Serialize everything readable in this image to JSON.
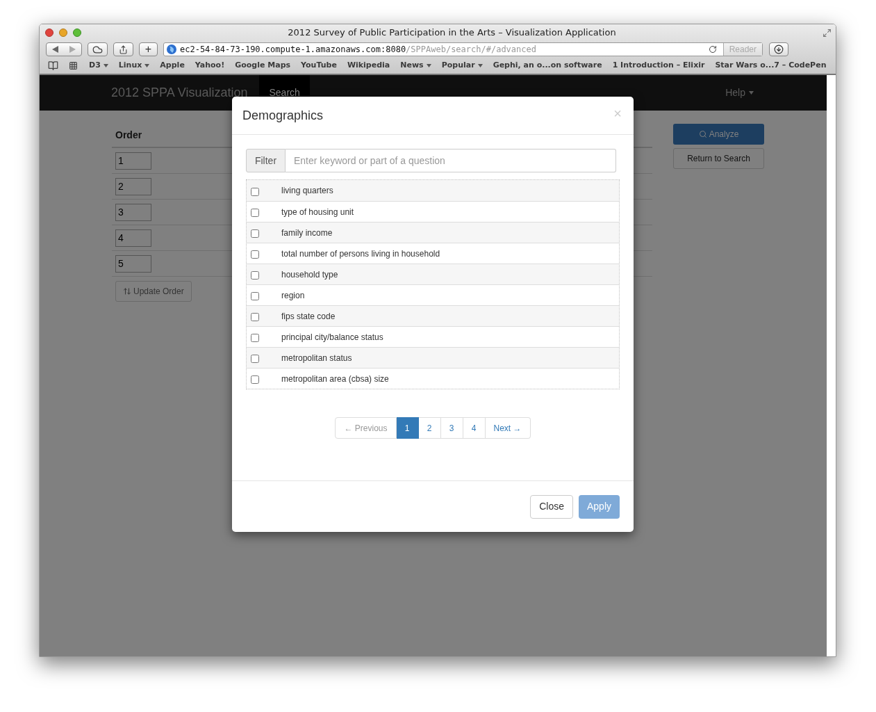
{
  "browser": {
    "title": "2012 Survey of Public Participation in the Arts – Visualization Application",
    "address": {
      "host": "ec2-54-84-73-190.compute-1.amazonaws.com:8080",
      "path": "/SPPAweb/search/#/advanced"
    },
    "reader": "Reader",
    "new_tab": "+",
    "bookmarks": [
      {
        "label": "D3",
        "menu": true
      },
      {
        "label": "Linux",
        "menu": true
      },
      {
        "label": "Apple",
        "menu": false
      },
      {
        "label": "Yahoo!",
        "menu": false
      },
      {
        "label": "Google Maps",
        "menu": false
      },
      {
        "label": "YouTube",
        "menu": false
      },
      {
        "label": "Wikipedia",
        "menu": false
      },
      {
        "label": "News",
        "menu": true
      },
      {
        "label": "Popular",
        "menu": true
      },
      {
        "label": "Gephi, an o...on software",
        "menu": false
      },
      {
        "label": "1 Introduction – Elixir",
        "menu": false
      },
      {
        "label": "Star Wars o...7 – CodePen",
        "menu": false
      }
    ]
  },
  "app": {
    "brand": "2012 SPPA Visualization",
    "nav": [
      {
        "label": "Search",
        "selected": true
      }
    ],
    "help": "Help"
  },
  "order": {
    "header": "Order",
    "inputs": [
      "1",
      "2",
      "3",
      "4",
      "5"
    ],
    "update_button": "Update Order"
  },
  "actions": {
    "analyze": "Analyze",
    "return": "Return to Search"
  },
  "modal": {
    "title": "Demographics",
    "close": "×",
    "filter_label": "Filter",
    "filter_placeholder": "Enter keyword or part of a question",
    "items": [
      {
        "label": "living quarters",
        "checked": false
      },
      {
        "label": "type of housing unit",
        "checked": false
      },
      {
        "label": "family income",
        "checked": false
      },
      {
        "label": "total number of persons living in household",
        "checked": false
      },
      {
        "label": "household type",
        "checked": false
      },
      {
        "label": "region",
        "checked": false
      },
      {
        "label": "fips state code",
        "checked": false
      },
      {
        "label": "principal city/balance status",
        "checked": false
      },
      {
        "label": "metropolitan status",
        "checked": false
      },
      {
        "label": "metropolitan area (cbsa) size",
        "checked": false
      }
    ],
    "pagination": {
      "previous": "← Previous",
      "pages": [
        {
          "label": "1",
          "selected": true
        },
        {
          "label": "2",
          "selected": false
        },
        {
          "label": "3",
          "selected": false
        },
        {
          "label": "4",
          "selected": false
        }
      ],
      "next": "Next →"
    },
    "close_button": "Close",
    "apply_button": {
      "label": "Apply",
      "disabled": true
    }
  }
}
